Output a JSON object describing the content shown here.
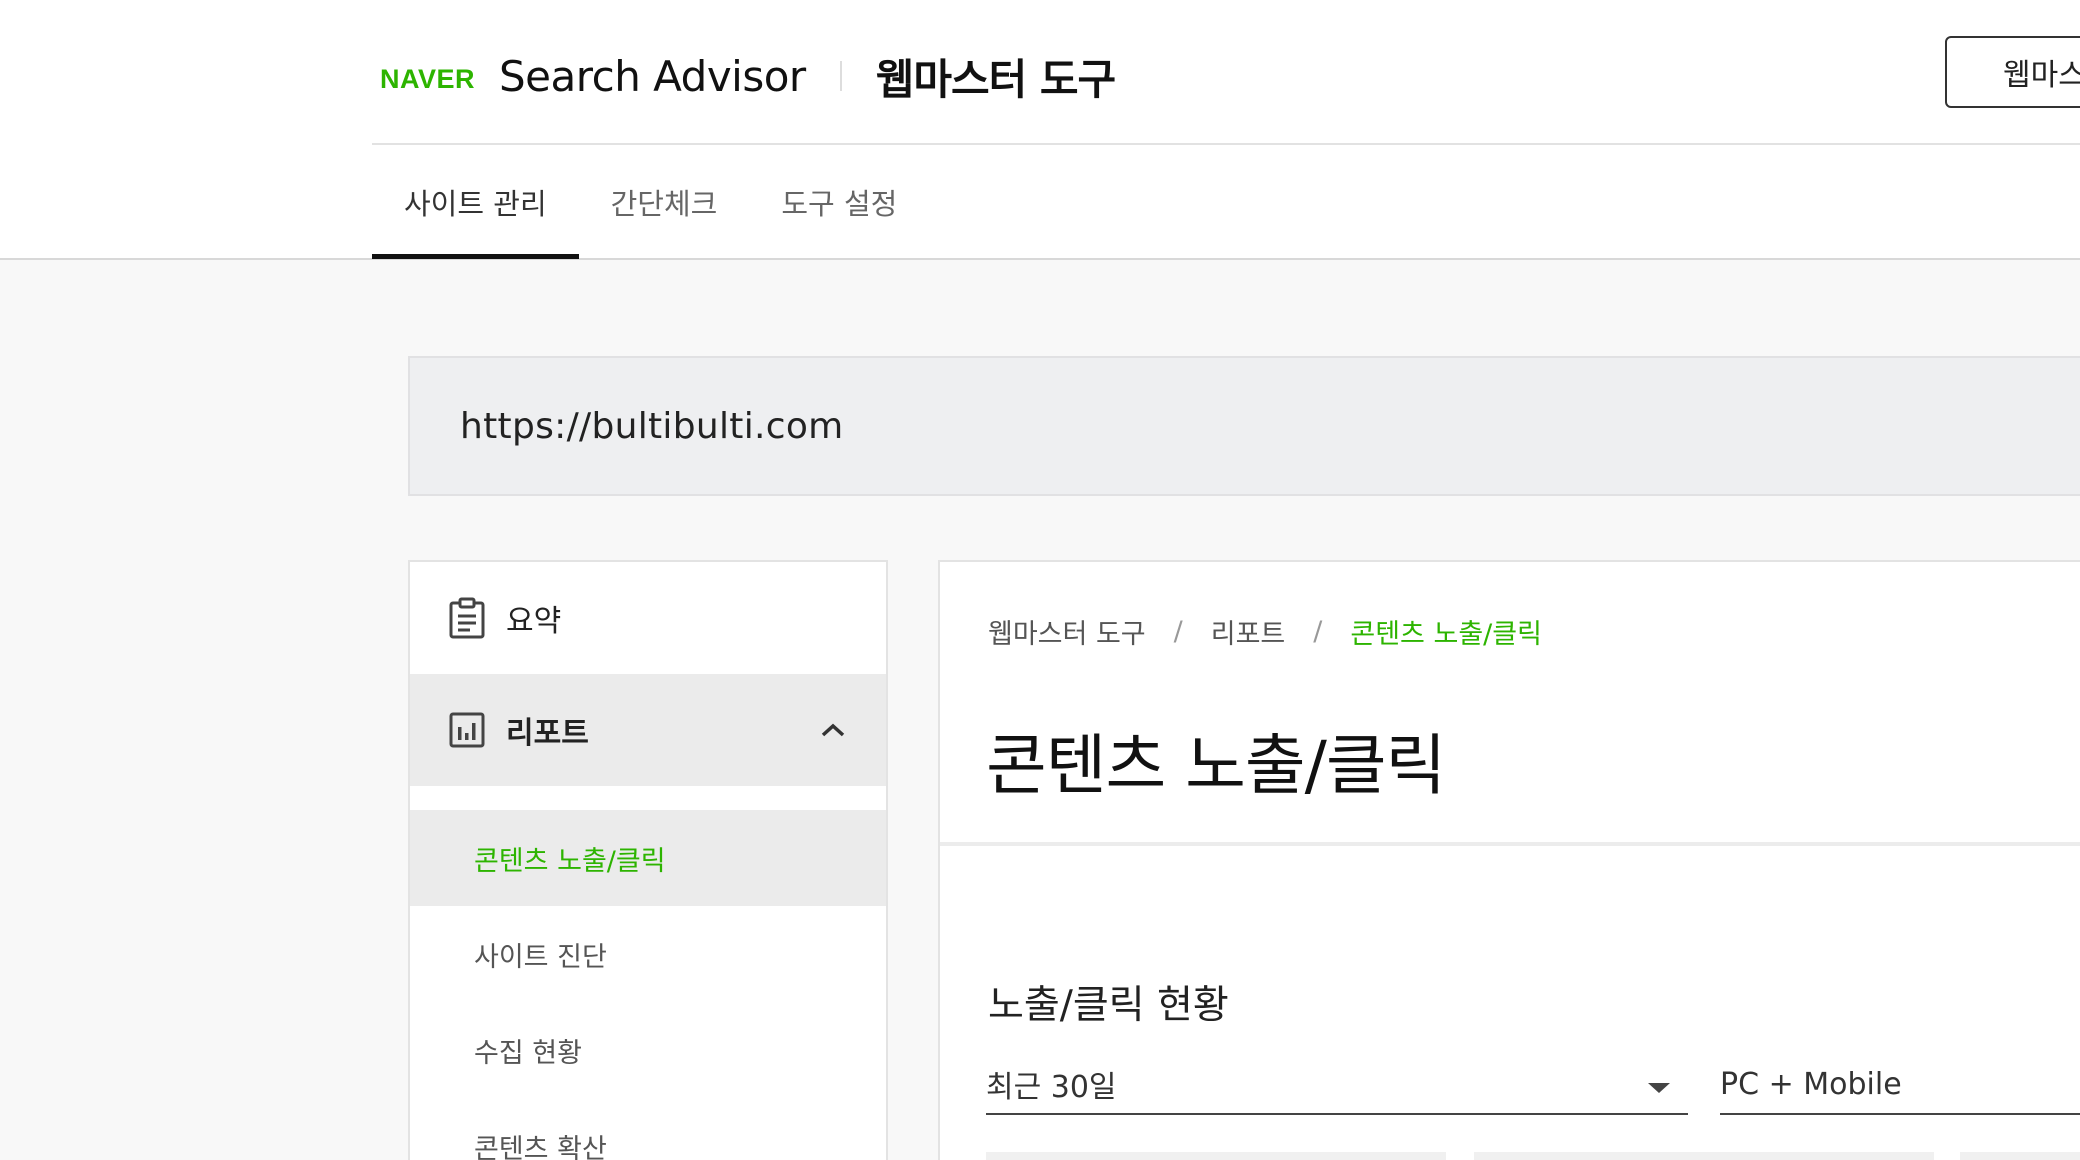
{
  "header": {
    "logo": "NAVER",
    "product": "Search Advisor",
    "tool": "웹마스터 도구",
    "guide_button": "웹마스터 가이드"
  },
  "tabs": [
    {
      "label": "사이트 관리",
      "active": true
    },
    {
      "label": "간단체크",
      "active": false
    },
    {
      "label": "도구 설정",
      "active": false
    }
  ],
  "site": {
    "url": "https://bultibulti.com"
  },
  "sidebar": {
    "summary": "요약",
    "report": "리포트",
    "report_items": [
      {
        "label": "콘텐츠 노출/클릭",
        "active": true
      },
      {
        "label": "사이트 진단",
        "active": false
      },
      {
        "label": "수집 현황",
        "active": false
      },
      {
        "label": "콘텐츠 확산",
        "active": false
      }
    ]
  },
  "breadcrumb": [
    "웹마스터 도구",
    "리포트",
    "콘텐츠 노출/클릭"
  ],
  "page_title": "콘텐츠 노출/클릭",
  "section": {
    "title": "노출/클릭 현황",
    "period": "최근 30일",
    "device": "PC + Mobile"
  },
  "colors": {
    "accent": "#2db400",
    "text": "#222222",
    "muted": "#666666"
  }
}
